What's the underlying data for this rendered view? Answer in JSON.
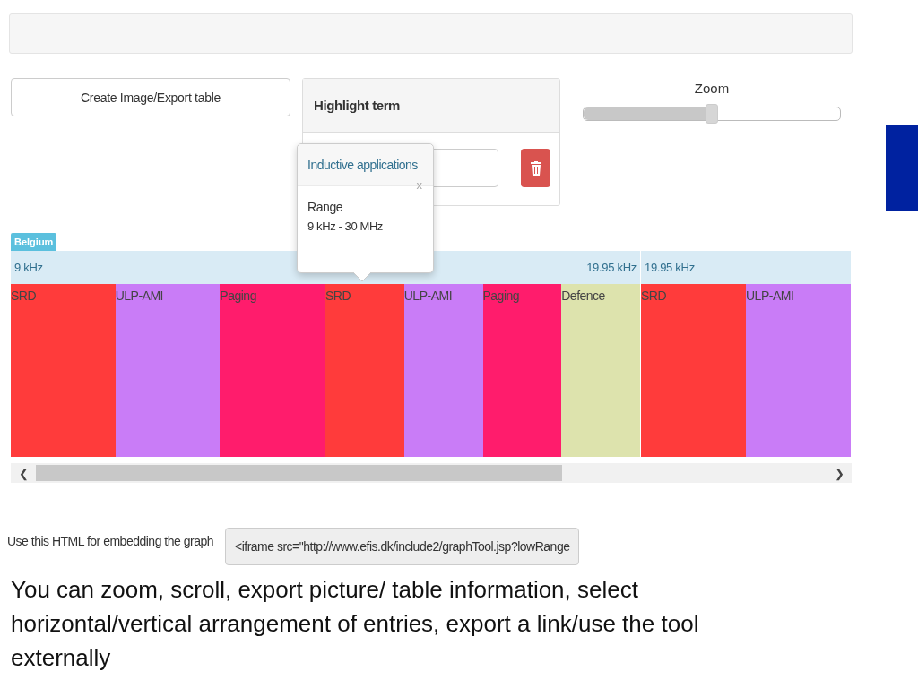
{
  "export_button": {
    "label": "Create Image/Export table"
  },
  "highlight": {
    "title": "Highlight term"
  },
  "zoom": {
    "label": "Zoom",
    "level": 0.5
  },
  "popover": {
    "title": "Inductive applications",
    "close": "x",
    "heading": "Range",
    "text": "9 kHz - 30 MHz"
  },
  "chart": {
    "country": "Belgium",
    "groups": [
      {
        "start_label": "9 kHz",
        "segments": [
          {
            "name": "SRD",
            "color": "#ff3b3b"
          },
          {
            "name": "ULP-AMI",
            "color": "#c97cf7"
          },
          {
            "name": "Paging",
            "color": "#ff1c6c"
          }
        ]
      },
      {
        "end_label": "19.95 kHz",
        "segments": [
          {
            "name": "SRD",
            "color": "#ff3b3b"
          },
          {
            "name": "ULP-AMI",
            "color": "#c97cf7"
          },
          {
            "name": "Paging",
            "color": "#ff1c6c"
          },
          {
            "name": "Defence",
            "color": "#dde3ad"
          }
        ]
      },
      {
        "start_label": "19.95 kHz",
        "segments": [
          {
            "name": "SRD",
            "color": "#ff3b3b"
          },
          {
            "name": "ULP-AMI",
            "color": "#c97cf7"
          }
        ]
      }
    ]
  },
  "scrollbar": {
    "left_arrow": "❮",
    "right_arrow": "❯"
  },
  "embed": {
    "label": "Use this HTML for embedding the graph",
    "value": "<iframe src=\"http://www.efis.dk/include2/graphTool.jsp?lowRange"
  },
  "caption": "You can zoom, scroll, export picture/ table information, select horizontal/vertical arrangement of entries, export a link/use the tool externally"
}
